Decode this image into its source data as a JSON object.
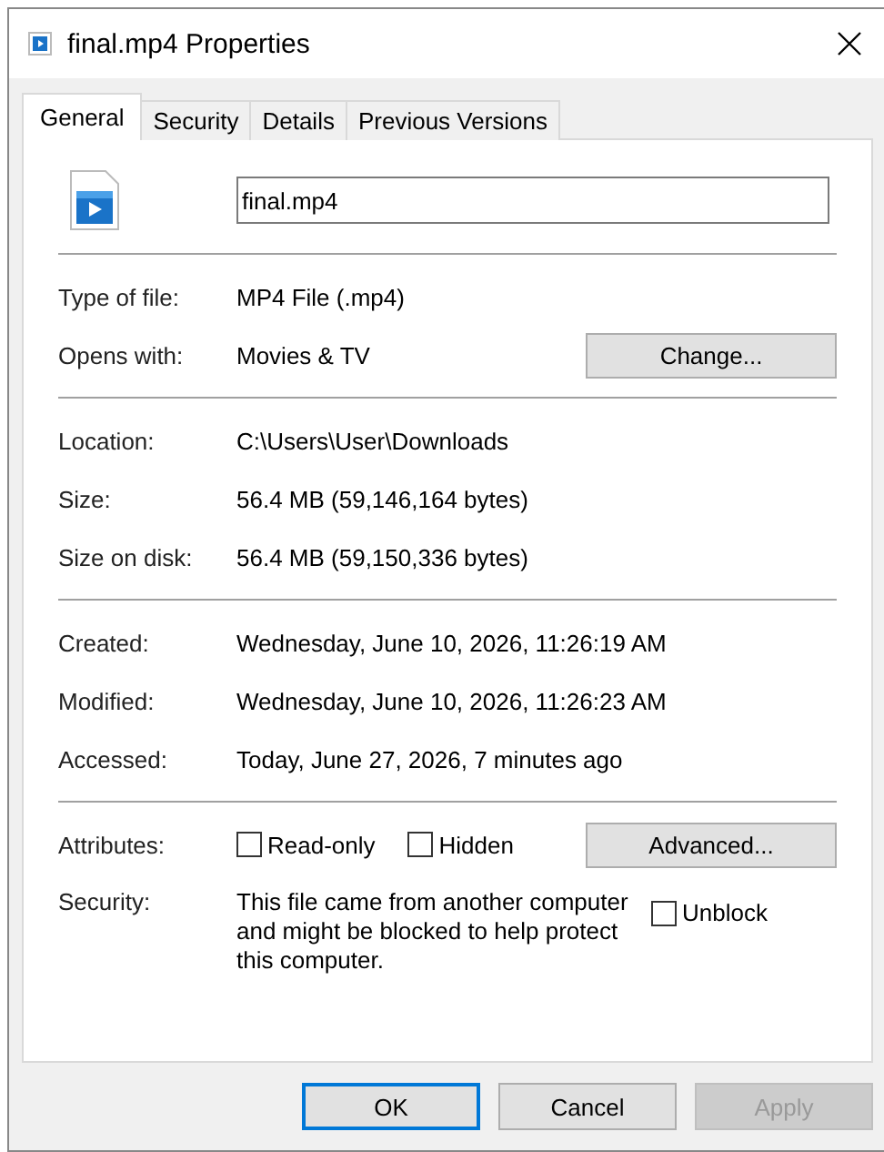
{
  "window": {
    "title": "final.mp4 Properties"
  },
  "tabs": [
    {
      "label": "General",
      "selected": true
    },
    {
      "label": "Security",
      "selected": false
    },
    {
      "label": "Details",
      "selected": false
    },
    {
      "label": "Previous Versions",
      "selected": false
    }
  ],
  "file_name": "final.mp4",
  "sections": [
    [
      {
        "label": "Type of file:",
        "value": "MP4 File (.mp4)"
      },
      {
        "label": "Opens with:",
        "value": "Movies & TV",
        "button": "Change..."
      }
    ],
    [
      {
        "label": "Location:",
        "value": "C:\\Users\\User\\Downloads"
      },
      {
        "label": "Size:",
        "value": "56.4 MB (59,146,164 bytes)"
      },
      {
        "label": "Size on disk:",
        "value": "56.4 MB (59,150,336 bytes)"
      }
    ],
    [
      {
        "label": "Created:",
        "value": "Wednesday, June 10, 2026, 11:26:19 AM"
      },
      {
        "label": "Modified:",
        "value": "Wednesday, June 10, 2026, 11:26:23 AM"
      },
      {
        "label": "Accessed:",
        "value": "Today, June 27, 2026, 7 minutes ago"
      }
    ]
  ],
  "attributes": {
    "label": "Attributes:",
    "options": [
      {
        "label": "Read-only",
        "checked": false
      },
      {
        "label": "Hidden",
        "checked": false
      }
    ],
    "button": "Advanced..."
  },
  "security": {
    "label": "Security:",
    "text": "This file came from another computer and might be blocked to help protect this computer.",
    "option": {
      "label": "Unblock",
      "checked": false
    }
  },
  "buttons": [
    {
      "label": "OK",
      "disabled": false,
      "default": true
    },
    {
      "label": "Cancel",
      "disabled": false,
      "default": false
    },
    {
      "label": "Apply",
      "disabled": true,
      "default": false
    }
  ]
}
